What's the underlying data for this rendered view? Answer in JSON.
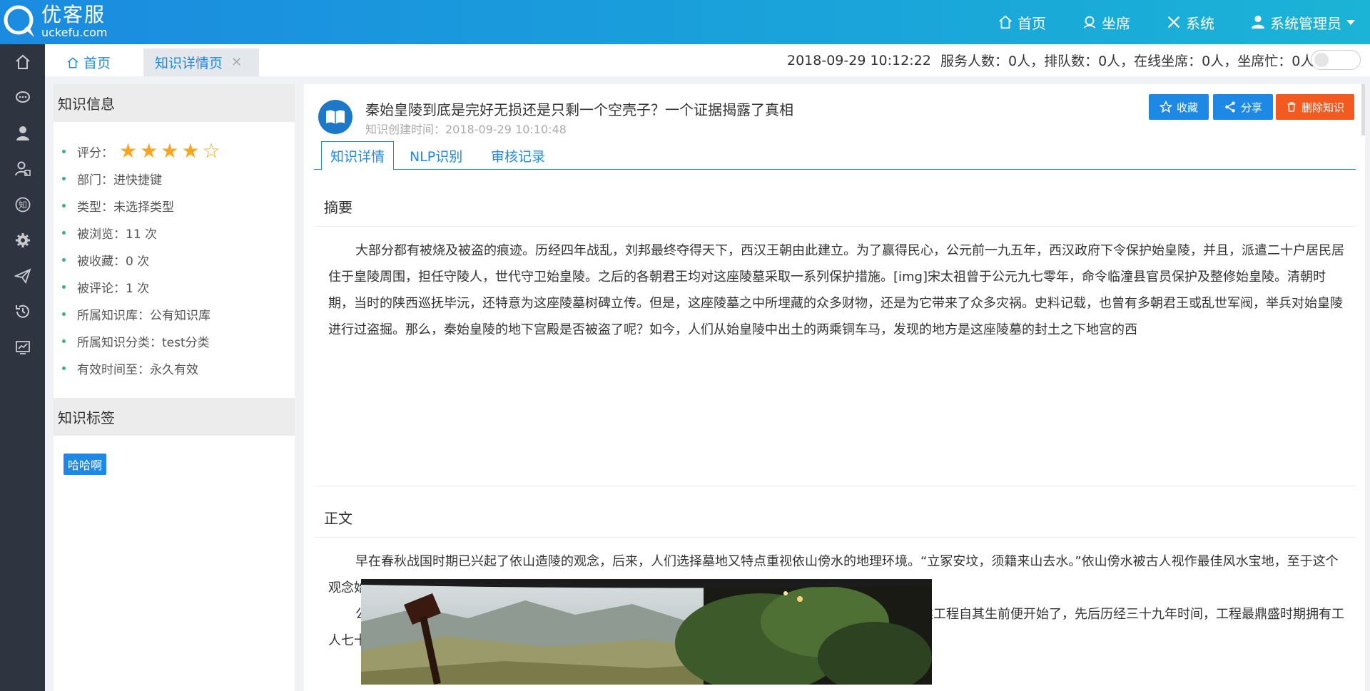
{
  "app": {
    "logo_title": "优客服",
    "logo_sub": "uckefu.com"
  },
  "topnav": {
    "home": "首页",
    "agent": "坐席",
    "system": "系统",
    "user": "系统管理员"
  },
  "tabs": {
    "home": "首页",
    "active": "知识详情页",
    "close": "✕"
  },
  "status": {
    "datetime": "2018-09-29 10:12:22",
    "summary": "服务人数：0人，排队数：0人，在线坐席：0人，坐席忙：0人"
  },
  "info": {
    "title": "知识信息",
    "rating_label": "评分：",
    "rating": 4,
    "rating_max": 5,
    "items": [
      "部门：进快捷键",
      "类型：未选择类型",
      "被浏览：11 次",
      "被收藏：0 次",
      "被评论：1 次",
      "所属知识库：公有知识库",
      "所属知识分类：test分类",
      "有效时间至：永久有效"
    ],
    "tags_title": "知识标签",
    "tag": "哈哈啊"
  },
  "knowledge": {
    "title": "秦始皇陵到底是完好无损还是只剩一个空壳子？一个证据揭露了真相",
    "created": "知识创建时间：2018-09-29 10:10:48",
    "buttons": {
      "favorite": "收藏",
      "share": "分享",
      "delete": "删除知识"
    },
    "subtabs": [
      "知识详情",
      "NLP识别",
      "审核记录"
    ],
    "summary_title": "摘要",
    "summary_text": "大部分都有被烧及被盗的痕迹。历经四年战乱，刘邦最终夺得天下，西汉王朝由此建立。为了赢得民心，公元前一九五年，西汉政府下令保护始皇陵，并且，派遣二十户居民居住于皇陵周围，担任守陵人，世代守卫始皇陵。之后的各朝君王均对这座陵墓采取一系列保护措施。[img]宋太祖曾于公元九七零年，命令临潼县官员保护及整修始皇陵。清朝时期，当时的陕西巡抚毕沅，还特意为这座陵墓树碑立传。但是，这座陵墓之中所埋藏的众多财物，还是为它带来了众多灾祸。史料记载，也曾有多朝君王或乱世军阀，举兵对始皇陵进行过盗掘。那么，秦始皇陵的地下宫殿是否被盗了呢？如今，人们从始皇陵中出土的两乘铜车马，发现的地方是这座陵墓的封土之下地宫的西",
    "body_title": "正文",
    "body_p1": "早在春秋战国时期已兴起了依山造陵的观念，后来，人们选择墓地又特点重视依山傍水的地理环境。“立冢安坟，须籍来山去水。”依山傍水被古人视作最佳风水宝地，至于这个观念始于何时，无从考起。应该说：秦始皇陵是“依山傍水”造陵的典范。",
    "body_p2": "公元前二一零年的夏天，始皇帝秦王嬴政去世。其灵柩被葬于一座十分宏大的陵墓之中，此陵墓的修建工程自其生前便开始了，先后历经三十九年时间，工程最鼎盛时期拥有工人七十余万，相当于当时全国总人数的十分之一！"
  },
  "colors": {
    "accent": "#1e88e5",
    "danger": "#f25a1f",
    "sidebar": "#2f3540",
    "star": "#f5a623"
  }
}
